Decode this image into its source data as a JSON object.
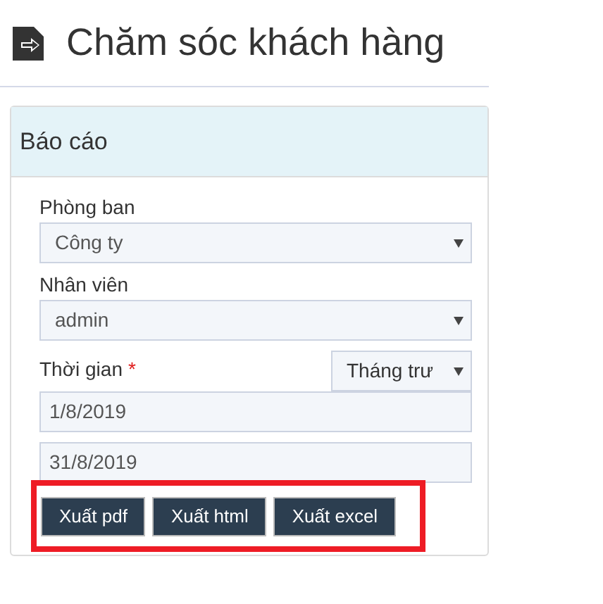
{
  "page": {
    "title": "Chăm sóc khách hàng"
  },
  "panel": {
    "title": "Báo cáo",
    "fields": [
      {
        "label": "Phòng ban",
        "value": "Công ty"
      },
      {
        "label": "Nhân viên",
        "value": "admin"
      }
    ],
    "period": {
      "label": "Thời gian",
      "required_mark": "*",
      "range": "Tháng trư",
      "from": "1/8/2019",
      "to": "31/8/2019"
    },
    "buttons": [
      "Xuất pdf",
      "Xuất html",
      "Xuất excel"
    ]
  }
}
